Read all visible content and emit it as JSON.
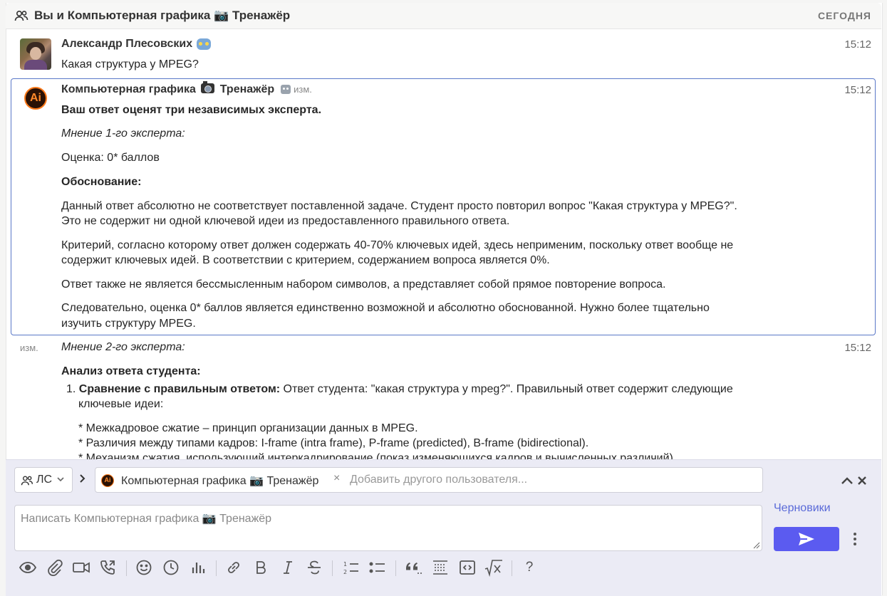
{
  "header": {
    "title": "Вы и Компьютерная графика 📷 Тренажёр",
    "date_label": "СЕГОДНЯ"
  },
  "messages": [
    {
      "sender": "Александр Плесовских",
      "time": "15:12",
      "text": "Какая структура у MPEG?"
    },
    {
      "sender_prefix": "Компьютерная графика",
      "sender_suffix": "Тренажёр",
      "edited": "изм.",
      "time": "15:12",
      "lines": [
        "Ваш ответ оценят три независимых эксперта.",
        "Мнение 1-го эксперта:",
        "Оценка: 0* баллов",
        "Обоснование:",
        "Данный ответ абсолютно не соответствует поставленной задаче. Студент просто повторил вопрос \"Какая структура у MPEG?\".",
        "Это не содержит ни одной ключевой идеи из предоставленного правильного ответа.",
        "Критерий, согласно которому ответ должен содержать 40-70% ключевых идей, здесь неприменим, поскольку ответ вообще не",
        "содержит ключевых идей. В соответствии с критерием, содержанием вопроса является 0%.",
        "Ответ также не является бессмысленным набором символов, а представляет собой прямое повторение вопроса.",
        "Следовательно, оценка 0* баллов является единственно возможной и абсолютно обоснованной. Нужно более тщательно",
        "изучить структуру MPEG."
      ]
    },
    {
      "edited": "изм.",
      "time": "15:12",
      "title": "Мнение 2-го эксперта:",
      "analysis_heading": "Анализ ответа студента:",
      "item1_bold": "Сравнение с правильным ответом:",
      "item1_text": " Ответ студента: \"какая структура у mpeg?\". Правильный ответ содержит следующие",
      "item1_cont": "ключевые идеи:",
      "bullets": [
        "* Межкадровое сжатие – принцип организации данных в MPEG.",
        "* Различия между типами кадров: I-frame (intra frame), P-frame (predicted), B-frame (bidirectional).",
        "* Механизм сжатия, использующий интеркадрирование (показ изменяющихся кадров и вычисленных различий)."
      ]
    }
  ],
  "compose": {
    "dm_label": "ЛС",
    "recipient": "Компьютерная графика 📷 Тренажёр",
    "remove_symbol": "×",
    "add_user_placeholder": "Добавить другого пользователя...",
    "message_placeholder": "Написать Компьютерная графика 📷 Тренажёр",
    "drafts_label": "Черновики",
    "help_label": "?"
  },
  "colors": {
    "accent": "#5b5bf0",
    "selected_border": "#5a78c8",
    "ai_orange": "#ff7a1a"
  }
}
